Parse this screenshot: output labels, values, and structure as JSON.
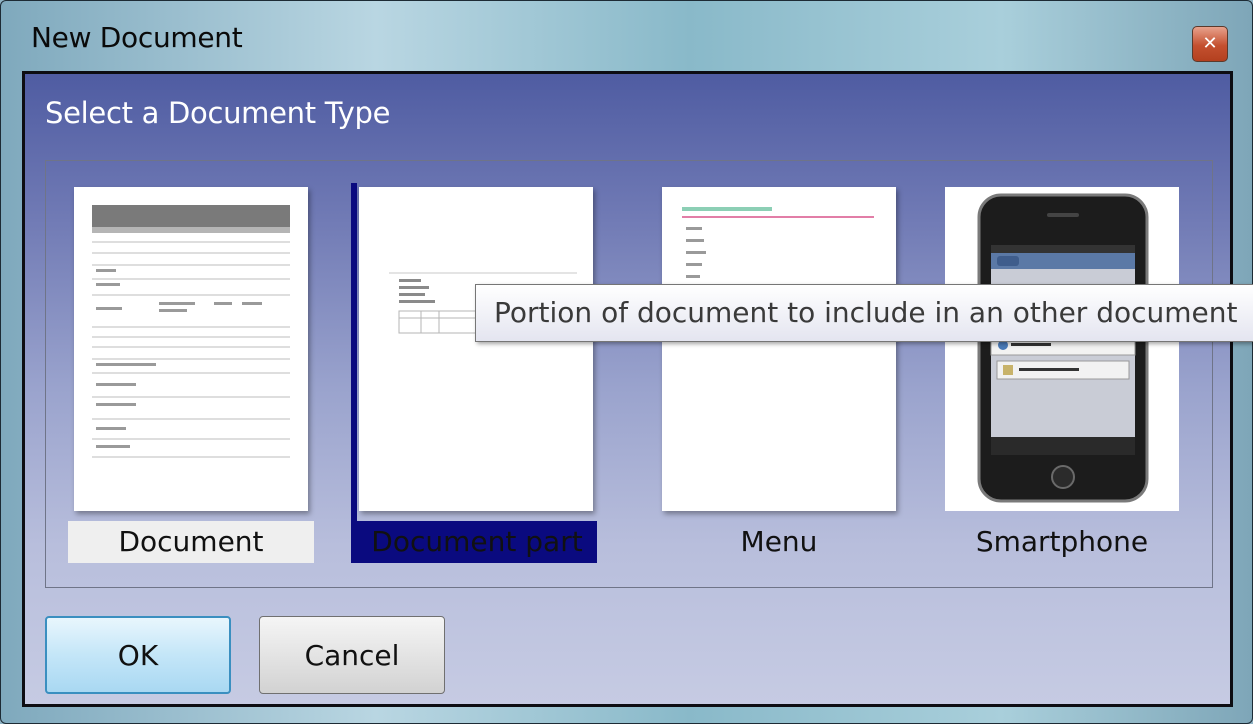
{
  "window": {
    "title": "New Document",
    "close_icon": "close-icon"
  },
  "dialog": {
    "heading": "Select a Document Type",
    "items": [
      {
        "label": "Document",
        "icon": "document-thumbnail"
      },
      {
        "label": "Document part",
        "icon": "document-part-thumbnail",
        "selected": true
      },
      {
        "label": "Menu",
        "icon": "menu-thumbnail"
      },
      {
        "label": "Smartphone",
        "icon": "smartphone-thumbnail"
      }
    ],
    "tooltip": "Portion of document to include in an other document",
    "buttons": {
      "ok": "OK",
      "cancel": "Cancel"
    }
  },
  "colors": {
    "selection": "#0a0a7f",
    "client_top": "#4f5ca2",
    "client_bottom": "#c6cbe3"
  }
}
